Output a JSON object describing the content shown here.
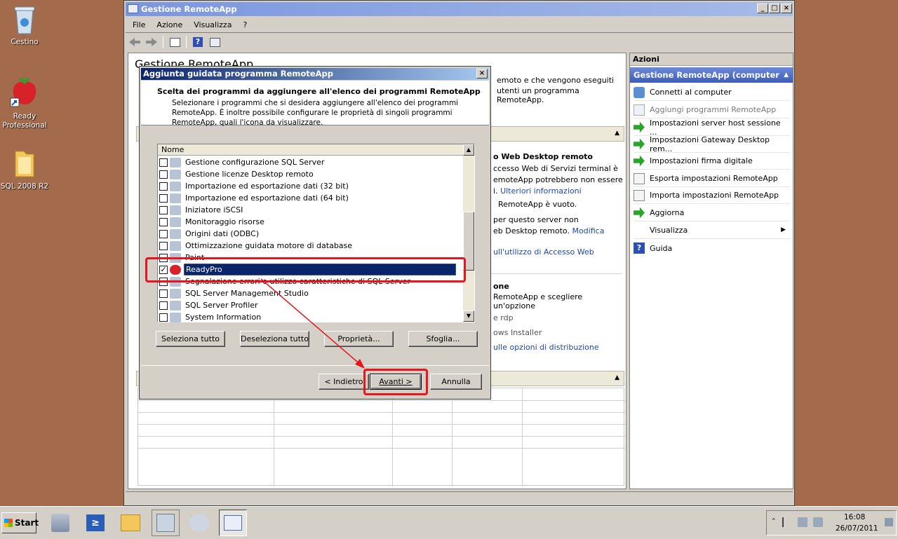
{
  "desktop": {
    "icons": [
      {
        "label": "Cestino"
      },
      {
        "label": "Ready Professional"
      },
      {
        "label": "SQL 2008 R2"
      }
    ]
  },
  "window": {
    "title": "Gestione RemoteApp",
    "menu": [
      "File",
      "Azione",
      "Visualizza",
      "?"
    ],
    "main_heading": "Gestione RemoteApp",
    "bg_text": {
      "intro_1": "emoto e che vengono eseguiti",
      "intro_2": "utenti un programma RemoteApp.",
      "section1_title": "o Web Desktop remoto",
      "s1_l1": "ccesso Web di Servizi terminal è",
      "s1_l2": "emoteApp potrebbero non essere",
      "s1_l3a": "i.",
      "s1_link1": "Ulteriori informazioni",
      "s1_l4": "RemoteApp è vuoto.",
      "s1_l5": "per questo server non",
      "s1_l6": "eb Desktop remoto.",
      "s1_link2": "Modifica",
      "s1_link3": "ull'utilizzo di Accesso Web",
      "section2_title": "one",
      "s2_l1": "RemoteApp e scegliere un'opzione",
      "s2_l2": "e rdp",
      "s2_l3": "ows Installer",
      "s2_link": "ulle opzioni di distribuzione"
    }
  },
  "actions": {
    "title": "Azioni",
    "group": "Gestione RemoteApp (computer lo...",
    "items": [
      {
        "label": "Connetti al computer",
        "icon": "connect-icon"
      },
      {
        "label": "Aggiungi programmi RemoteApp",
        "icon": "add-program-icon",
        "disabled": true
      },
      {
        "label": "Impostazioni server host sessione ...",
        "icon": "green-arrow-icon"
      },
      {
        "label": "Impostazioni Gateway Desktop rem...",
        "icon": "green-arrow-icon"
      },
      {
        "label": "Impostazioni firma digitale",
        "icon": "green-arrow-icon"
      },
      {
        "label": "Esporta impostazioni RemoteApp",
        "icon": "export-icon"
      },
      {
        "label": "Importa impostazioni RemoteApp",
        "icon": "import-icon"
      },
      {
        "label": "Aggiorna",
        "icon": "green-arrow-icon"
      },
      {
        "label": "Visualizza",
        "icon": "",
        "submenu": true
      },
      {
        "label": "Guida",
        "icon": "help-icon"
      }
    ]
  },
  "dialog": {
    "title": "Aggiunta guidata programma RemoteApp",
    "heading": "Scelta dei programmi da aggiungere all'elenco dei programmi RemoteApp",
    "desc_1": "Selezionare i programmi che si desidera aggiungere all'elenco dei programmi",
    "desc_2": "RemoteApp. È inoltre possibile configurare le proprietà di singoli programmi",
    "desc_3": "RemoteApp, quali l'icona da visualizzare.",
    "column_header": "Nome",
    "programs": [
      {
        "name": "Gestione configurazione SQL Server",
        "checked": false
      },
      {
        "name": "Gestione licenze Desktop remoto",
        "checked": false
      },
      {
        "name": "Importazione ed esportazione dati (32 bit)",
        "checked": false
      },
      {
        "name": "Importazione ed esportazione dati (64 bit)",
        "checked": false
      },
      {
        "name": "Iniziatore iSCSI",
        "checked": false
      },
      {
        "name": "Monitoraggio risorse",
        "checked": false
      },
      {
        "name": "Origini dati (ODBC)",
        "checked": false
      },
      {
        "name": "Ottimizzazione guidata motore di database",
        "checked": false
      },
      {
        "name": "Paint",
        "checked": false
      },
      {
        "name": "ReadyPro",
        "checked": true,
        "selected": true
      },
      {
        "name": "Segnalazione errori e utilizzo caratteristiche di SQL Server",
        "checked": false
      },
      {
        "name": "SQL Server Management Studio",
        "checked": false
      },
      {
        "name": "SQL Server Profiler",
        "checked": false
      },
      {
        "name": "System Information",
        "checked": false
      }
    ],
    "buttons": {
      "select_all": "Seleziona tutto",
      "deselect_all": "Deseleziona tutto",
      "properties": "Proprietà...",
      "browse": "Sfoglia...",
      "back": "< Indietro",
      "next": "Avanti >",
      "cancel": "Annulla"
    }
  },
  "taskbar": {
    "start": "Start",
    "time": "16:08",
    "date": "26/07/2011"
  },
  "colors": {
    "desktop": "#a36a4c",
    "highlight": "#0a246a",
    "annotation": "#e8161c"
  }
}
